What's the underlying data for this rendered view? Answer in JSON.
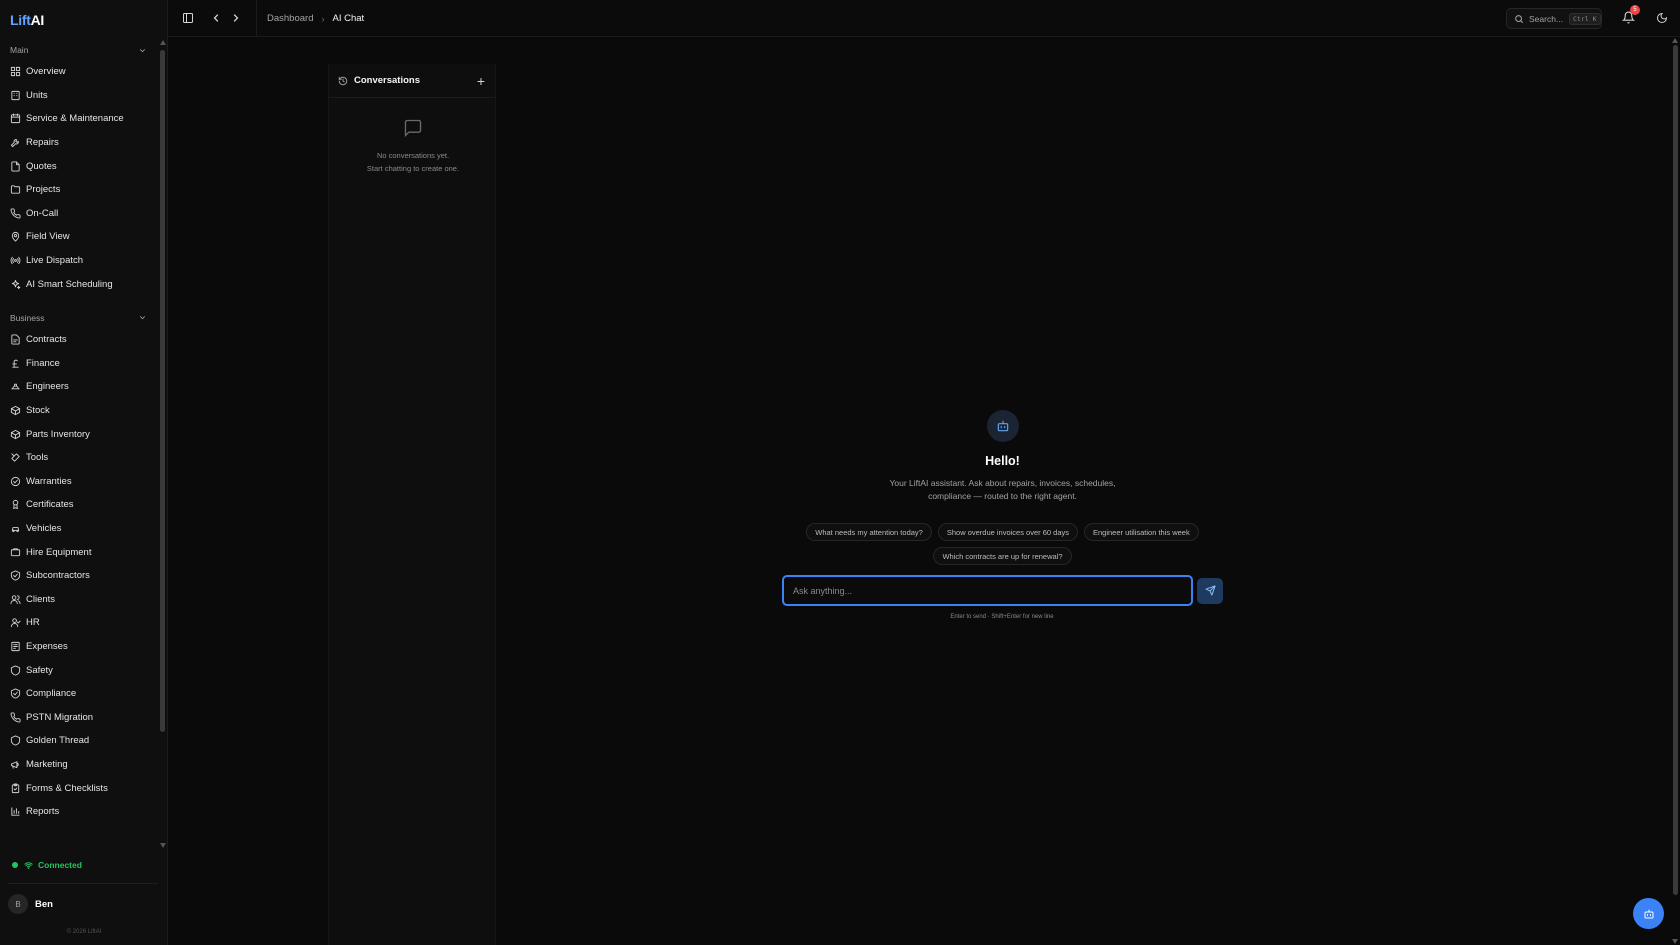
{
  "app": {
    "logo_part1": "Lift",
    "logo_part2": "AI"
  },
  "sidebar": {
    "sections": [
      {
        "label": "Main",
        "items": [
          "Overview",
          "Units",
          "Service & Maintenance",
          "Repairs",
          "Quotes",
          "Projects",
          "On-Call",
          "Field View",
          "Live Dispatch",
          "AI Smart Scheduling"
        ]
      },
      {
        "label": "Business",
        "items": [
          "Contracts",
          "Finance",
          "Engineers",
          "Stock",
          "Parts Inventory",
          "Tools",
          "Warranties",
          "Certificates",
          "Vehicles",
          "Hire Equipment",
          "Subcontractors",
          "Clients",
          "HR",
          "Expenses",
          "Safety",
          "Compliance",
          "PSTN Migration",
          "Golden Thread",
          "Marketing",
          "Forms & Checklists",
          "Reports"
        ]
      }
    ],
    "status": "Connected",
    "user": {
      "initial": "B",
      "name": "Ben"
    },
    "copyright": "© 2026 LiftAI"
  },
  "topbar": {
    "breadcrumb": {
      "parent": "Dashboard",
      "current": "AI Chat"
    },
    "search_label": "Search...",
    "search_shortcut": "Ctrl K",
    "notification_count": "5"
  },
  "conversations": {
    "title": "Conversations",
    "add_label": "+",
    "empty_line1": "No conversations yet.",
    "empty_line2": "Start chatting to create one."
  },
  "chat": {
    "greeting": "Hello!",
    "subtitle": "Your LiftAI assistant. Ask about repairs, invoices, schedules, compliance — routed to the right agent.",
    "suggestions": [
      "What needs my attention today?",
      "Show overdue invoices over 60 days",
      "Engineer utilisation this week",
      "Which contracts are up for renewal?"
    ],
    "input_placeholder": "Ask anything...",
    "hint": "Enter to send · Shift+Enter for new line"
  },
  "colors": {
    "accent": "#3b82f6",
    "status_green": "#22c55e",
    "badge_red": "#ef4444",
    "background": "#0a0a0a"
  }
}
